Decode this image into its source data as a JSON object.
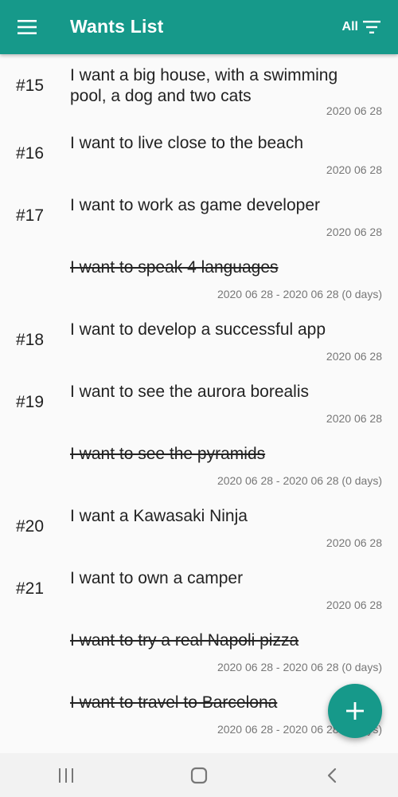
{
  "appbar": {
    "title": "Wants List",
    "filter_label": "All"
  },
  "colors": {
    "primary": "#16998a",
    "text": "#222222",
    "date": "#777777"
  },
  "items": [
    {
      "num": "#15",
      "text": "I want a big house, with a swimming pool, a dog and two cats",
      "date": "2020 06 28",
      "done": false
    },
    {
      "num": "#16",
      "text": "I want to live close to the beach",
      "date": "2020 06 28",
      "done": false
    },
    {
      "num": "#17",
      "text": "I want to work as game developer",
      "date": "2020 06 28",
      "done": false
    },
    {
      "num": "",
      "text": "I want to speak 4 languages",
      "date": "2020 06 28 - 2020 06 28 (0 days)",
      "done": true
    },
    {
      "num": "#18",
      "text": "I want to develop a  successful app",
      "date": "2020 06 28",
      "done": false
    },
    {
      "num": "#19",
      "text": "I want to see the aurora borealis",
      "date": "2020 06 28",
      "done": false
    },
    {
      "num": "",
      "text": "I want to see the pyramids",
      "date": "2020 06 28 - 2020 06 28 (0 days)",
      "done": true
    },
    {
      "num": "#20",
      "text": "I want a Kawasaki Ninja",
      "date": "2020 06 28",
      "done": false
    },
    {
      "num": "#21",
      "text": "I want to own a camper",
      "date": "2020 06 28",
      "done": false
    },
    {
      "num": "",
      "text": "I want to try a real Napoli pizza",
      "date": "2020 06 28 - 2020 06 28 (0 days)",
      "done": true
    },
    {
      "num": "",
      "text": "I want to travel to Barcelona",
      "date": "2020 06 28 - 2020 06 28 (0 days)",
      "done": true
    }
  ],
  "icons": {
    "menu": "menu-icon",
    "filter": "filter-icon",
    "add": "plus-icon",
    "recents": "recents-icon",
    "home": "home-icon",
    "back": "back-icon"
  }
}
